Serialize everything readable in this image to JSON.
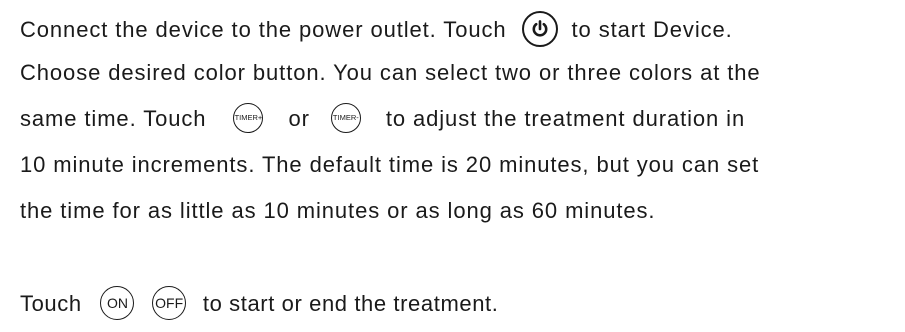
{
  "paragraph": {
    "line1_before": "Connect the device to the power outlet. Touch",
    "line1_after": "to start Device.",
    "line2": "Choose desired color button. You can select two or three colors at the",
    "line3_before": "same time. Touch",
    "line3_or": "or",
    "line3_after": "to adjust the  treatment duration in",
    "line4": "10 minute increments. The default time is  20 minutes, but you can set",
    "line5": "the time for as little as 10 minutes or as long as 60 minutes.",
    "line6_before": "Touch",
    "line6_after": "to start or end the treatment."
  },
  "icons": {
    "power": "power-icon",
    "timer_plus": {
      "name": "timer-plus-icon",
      "label": "TIMER+"
    },
    "timer_minus": {
      "name": "timer-minus-icon",
      "label": "TIMER-"
    },
    "on": {
      "name": "on-icon",
      "label": "ON"
    },
    "off": {
      "name": "off-icon",
      "label": "OFF"
    }
  },
  "colors": {
    "text": "#1a1a1a",
    "background": "#ffffff"
  }
}
